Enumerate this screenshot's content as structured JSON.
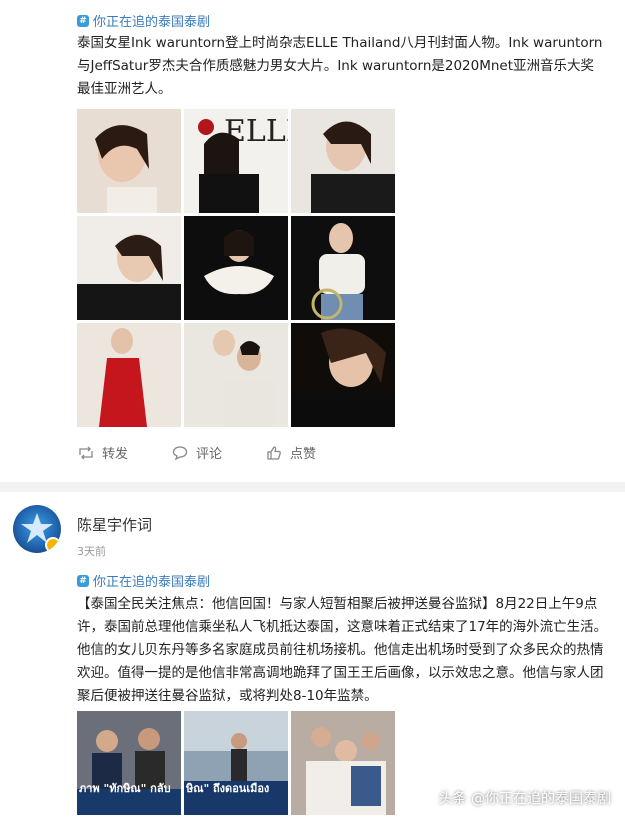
{
  "post1": {
    "topic": "你正在追的泰国泰剧",
    "text": "泰国女星Ink waruntorn登上时尚杂志ELLE Thailand八月刊封面人物。Ink waruntorn与JeffSatur罗杰夫合作质感魅力男女大片。Ink waruntorn是2020Mnet亚洲音乐大奖最佳亚洲艺人。",
    "actions": {
      "repost": "转发",
      "comment": "评论",
      "like": "点赞"
    }
  },
  "post2": {
    "author": "陈星宇作词",
    "time": "3天前",
    "topic": "你正在追的泰国泰剧",
    "text": "【泰国全民关注焦点：他信回国！与家人短暂相聚后被押送曼谷监狱】8月22日上午9点许，泰国前总理他信乘坐私人飞机抵达泰国，这意味着正式结束了17年的海外流亡生活。他信的女儿贝东丹等多名家庭成员前往机场接机。他信走出机场时受到了众多民众的热情欢迎。值得一提的是他信非常高调地跪拜了国王王后画像，以示效忠之意。他信与家人团聚后便被押送往曼谷监狱，或将判处8-10年监禁。",
    "image_captions": [
      "ภาพ \"ทักษิณ\" กลับ",
      "ษิณ\" ถึงดอนเมือง"
    ]
  },
  "watermark": "头条 @你正在追的泰国泰剧",
  "colors": {
    "topic": "#3a7cbf",
    "badge": "#f7b500"
  }
}
